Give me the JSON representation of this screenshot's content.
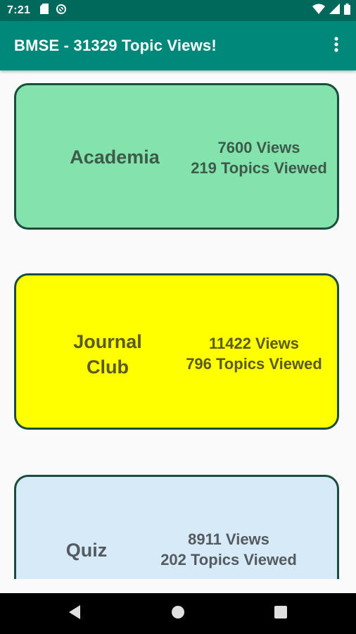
{
  "status_bar": {
    "time": "7:21",
    "icons_left": [
      "sd-card-icon",
      "sync-icon"
    ],
    "icons_right": [
      "wifi-icon",
      "signal-icon",
      "battery-icon"
    ]
  },
  "app_bar": {
    "title": "BMSE - 31329 Topic Views!",
    "menu_icon": "more-vert-icon"
  },
  "cards": [
    {
      "title_lines": [
        "Academia"
      ],
      "views": "7600 Views",
      "topics": "219 Topics Viewed",
      "color": "#84e3ad",
      "text_color": "#3d5a4a"
    },
    {
      "title_lines": [
        "Journal",
        "Club"
      ],
      "views": "11422 Views",
      "topics": "796 Topics Viewed",
      "color": "#ffff00",
      "text_color": "#5a5a1a"
    },
    {
      "title_lines": [
        "Quiz"
      ],
      "views": "8911 Views",
      "topics": "202 Topics Viewed",
      "color": "#d6eaf8",
      "text_color": "#555a60"
    }
  ],
  "nav_bar": {
    "buttons": [
      "back-icon",
      "home-icon",
      "recents-icon"
    ]
  }
}
